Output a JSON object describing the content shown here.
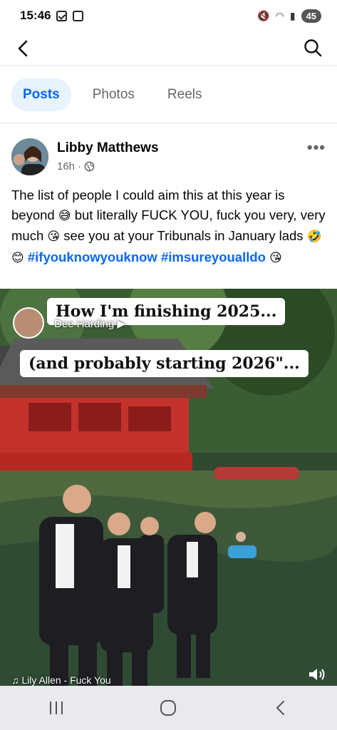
{
  "status_bar": {
    "time": "15:46",
    "battery": "45"
  },
  "tabs": [
    {
      "label": "Posts",
      "active": true
    },
    {
      "label": "Photos",
      "active": false
    },
    {
      "label": "Reels",
      "active": false
    }
  ],
  "post": {
    "author": "Libby Matthews",
    "time": "16h",
    "separator": "·",
    "text_parts": {
      "p1": "The list of people I could aim this at this year is beyond ",
      "e1": "😅",
      "p2": " but literally FUCK YOU, fuck you very, very much ",
      "e2": "😘",
      "p3": " see you at your Tribunals in January lads ",
      "e3": "🤣😊",
      "h1": "#ifyouknowyouknow",
      "h2": "#imsureyoualldo",
      "e4": "😘"
    }
  },
  "video": {
    "caption_line1": "How I'm finishing 2025...",
    "caption_line2": "(and probably starting 2026\"...",
    "overlay_user": "Dee Harding",
    "overlay_arrow": "▶",
    "music": "♫ Lily Allen - Fuck You"
  },
  "colors": {
    "accent": "#0866ff",
    "tab_active_bg": "#e7f3ff",
    "muted": "#65676b"
  }
}
